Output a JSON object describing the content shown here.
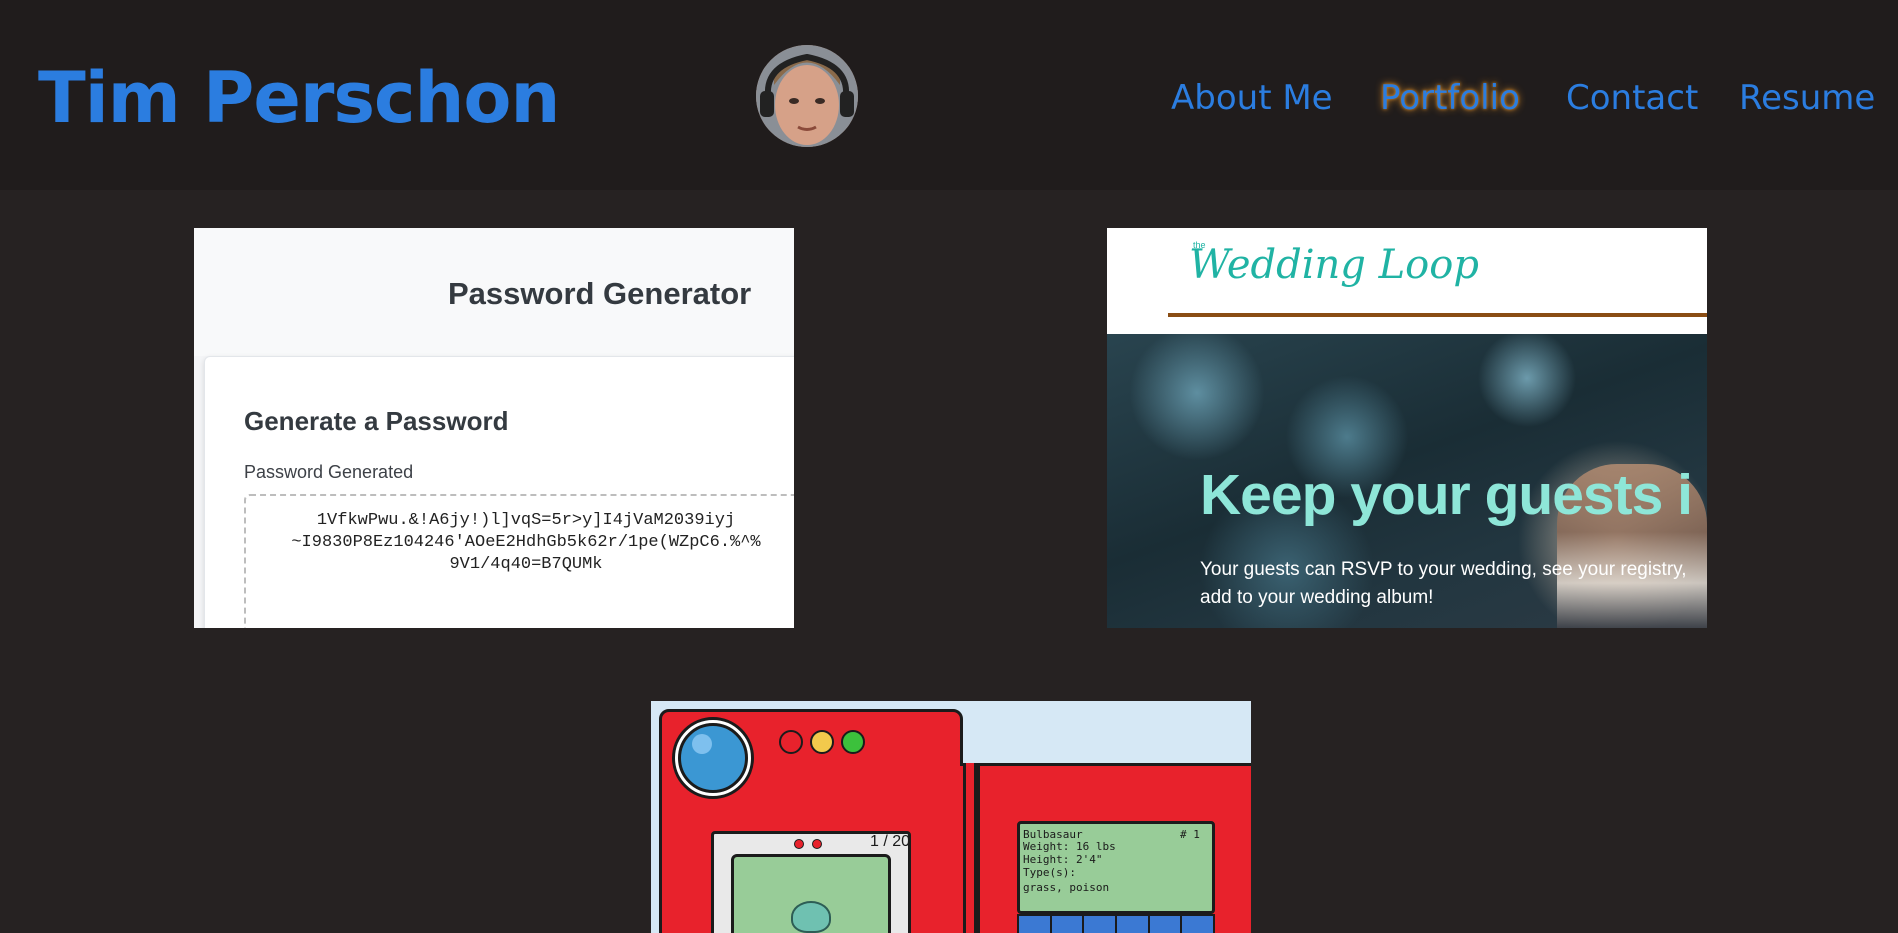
{
  "header": {
    "title": "Tim Perschon",
    "nav": [
      {
        "label": "About Me",
        "active": false
      },
      {
        "label": "Portfolio",
        "active": true
      },
      {
        "label": "Contact",
        "active": false
      },
      {
        "label": "Resume",
        "active": false
      }
    ]
  },
  "colors": {
    "page_bg": "#262222",
    "header_bg": "#201c1c",
    "link": "#2b7de0",
    "active_glow": "#d58a2a"
  },
  "projects": {
    "password": {
      "heading": "Password Generator",
      "subheading": "Generate a Password",
      "field_label": "Password Generated",
      "password_text": "1VfkwPwu.&!A6jy!)l]vqS=5r>y]I4jVaM2039iyj\n~I9830P8Ez104246'AOeE2HdhGb5k62r/1pe(WZpC6.%^%\n9V1/4q40=B7QUMk"
    },
    "wedding": {
      "logo_small": "the",
      "logo": "Wedding Loop",
      "headline": "Keep your guests i",
      "body": "Your guests can RSVP to your wedding, see your registry, add to your wedding album!"
    },
    "pokedex": {
      "counter": "1 / 20",
      "name": "Bulbasaur",
      "number": "# 1",
      "weight": "Weight: 16 lbs",
      "height": "Height: 2'4\"",
      "types_label": "Type(s):",
      "types": "grass, poison"
    }
  }
}
